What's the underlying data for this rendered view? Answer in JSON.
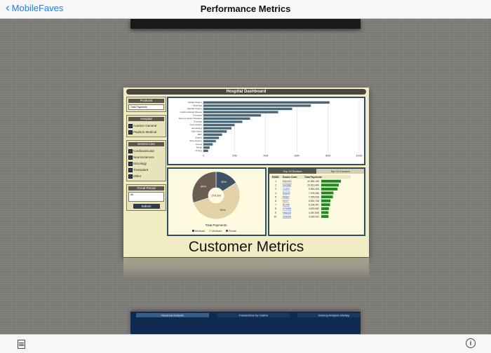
{
  "nav": {
    "back_label": "MobileFaves",
    "title": "Performance Metrics"
  },
  "dashboard": {
    "title": "Hospital Dashboard",
    "caption": "Customer Metrics",
    "filters": {
      "products_title": "Products",
      "products_value": "Total Payments",
      "hospital_title": "Hospital",
      "hospitals": [
        "Aranbor General",
        "Paulson Medical"
      ],
      "service_title": "Service Line",
      "services": [
        "Cardiovascular",
        "Neurosciences",
        "Oncology",
        "Transplant",
        "Other"
      ],
      "period_title": "Fiscal Period",
      "period_value": "All",
      "submit_label": "Submit"
    },
    "pie": {
      "caption": "Total Payments",
      "center": "270.2M",
      "legend": [
        "Medicaid",
        "Medicare",
        "Private"
      ]
    },
    "top_tabs": [
      "Top 10 Doctors",
      "Top 10 Insurers"
    ],
    "top_headers": [
      "RANK",
      "Doctor Code",
      "Total Payments"
    ],
    "doctors": [
      {
        "rank": "1",
        "code": "MA0082",
        "payments": "11,954,159",
        "share": 1.0
      },
      {
        "rank": "2",
        "code": "NA0986",
        "payments": "10,613,460",
        "share": 0.89
      },
      {
        "rank": "3",
        "code": "CA337",
        "payments": "9,952,268",
        "share": 0.83
      },
      {
        "rank": "4",
        "code": "RN025",
        "payments": "7,378,356",
        "share": 0.62
      },
      {
        "rank": "5",
        "code": "PA687",
        "payments": "7,095,928",
        "share": 0.59
      },
      {
        "rank": "6",
        "code": "DO07",
        "payments": "5,651,746",
        "share": 0.47
      },
      {
        "rank": "7",
        "code": "AL045",
        "payments": "5,334,491",
        "share": 0.45
      },
      {
        "rank": "8",
        "code": "NT9088",
        "payments": "4,623,982",
        "share": 0.39
      },
      {
        "rank": "9",
        "code": "HB1103",
        "payments": "4,467,846",
        "share": 0.37
      },
      {
        "rank": "10",
        "code": "ZS9096",
        "payments": "4,393,092",
        "share": 0.37
      }
    ]
  },
  "chart_data": [
    {
      "type": "bar",
      "orientation": "horizontal",
      "categories": [
        "Cardiac Surgery",
        "Cardiology",
        "Vascular Surgery",
        "Cerebrovascular Disease",
        "Transplant",
        "Nervous System Disorders",
        "Oncology",
        "Neurosurgery",
        "Hematology",
        "Other Neuro",
        "BMT",
        "Surgery",
        "Spine Surgery",
        "Trauma",
        "Rehab",
        "Urology"
      ],
      "values": [
        81,
        69,
        57,
        48,
        37,
        30,
        25,
        20,
        18,
        15,
        12,
        10,
        8,
        6,
        4,
        3
      ],
      "x_ticks": [
        "0",
        "20M",
        "40M",
        "60M",
        "80M",
        "100M"
      ],
      "xlim": [
        0,
        100
      ],
      "bar_color": "#4a6778"
    },
    {
      "type": "pie",
      "categories": [
        "Medicaid",
        "Medicare",
        "Private"
      ],
      "values": [
        16,
        54,
        30
      ],
      "labels": [
        "16%",
        "54%",
        "30%"
      ],
      "colors": [
        "#3e5264",
        "#e2d2a6",
        "#6a5d52"
      ]
    }
  ],
  "next_card": {
    "tabs": [
      "Revenue Analysis",
      "Transactions by Casino",
      "Gaming Analysis InfoApp"
    ]
  }
}
